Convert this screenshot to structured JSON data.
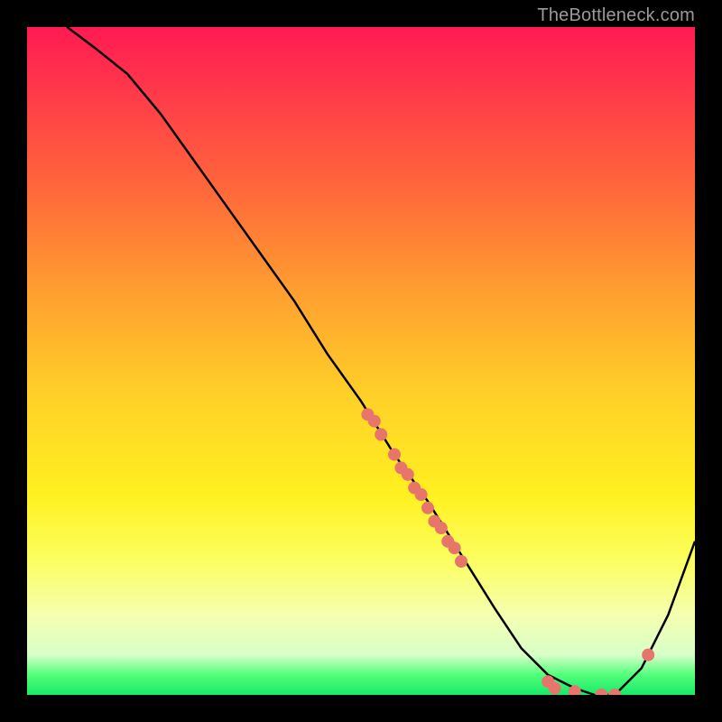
{
  "watermark": "TheBottleneck.com",
  "chart_data": {
    "type": "line",
    "title": "",
    "xlabel": "",
    "ylabel": "",
    "xlim": [
      0,
      100
    ],
    "ylim": [
      0,
      100
    ],
    "grid": false,
    "legend": false,
    "series": [
      {
        "name": "curve",
        "x": [
          6,
          10,
          15,
          20,
          25,
          30,
          35,
          40,
          45,
          50,
          55,
          60,
          65,
          70,
          74,
          78,
          82,
          85,
          88,
          92,
          96,
          100
        ],
        "y": [
          100,
          97,
          93,
          87,
          80,
          73,
          66,
          59,
          51,
          44,
          36,
          29,
          21,
          13,
          7,
          3,
          1,
          0,
          0,
          4,
          12,
          23
        ]
      }
    ],
    "points": [
      {
        "x": 51,
        "y": 42
      },
      {
        "x": 52,
        "y": 41
      },
      {
        "x": 53,
        "y": 39
      },
      {
        "x": 55,
        "y": 36
      },
      {
        "x": 56,
        "y": 34
      },
      {
        "x": 57,
        "y": 33
      },
      {
        "x": 58,
        "y": 31
      },
      {
        "x": 59,
        "y": 30
      },
      {
        "x": 60,
        "y": 28
      },
      {
        "x": 61,
        "y": 26
      },
      {
        "x": 62,
        "y": 25
      },
      {
        "x": 63,
        "y": 23
      },
      {
        "x": 64,
        "y": 22
      },
      {
        "x": 65,
        "y": 20
      },
      {
        "x": 78,
        "y": 2
      },
      {
        "x": 79,
        "y": 1
      },
      {
        "x": 82,
        "y": 0.5
      },
      {
        "x": 86,
        "y": 0
      },
      {
        "x": 88,
        "y": 0
      },
      {
        "x": 93,
        "y": 6
      }
    ],
    "colors": {
      "curve": "#000000",
      "points": "#e8756b"
    }
  }
}
